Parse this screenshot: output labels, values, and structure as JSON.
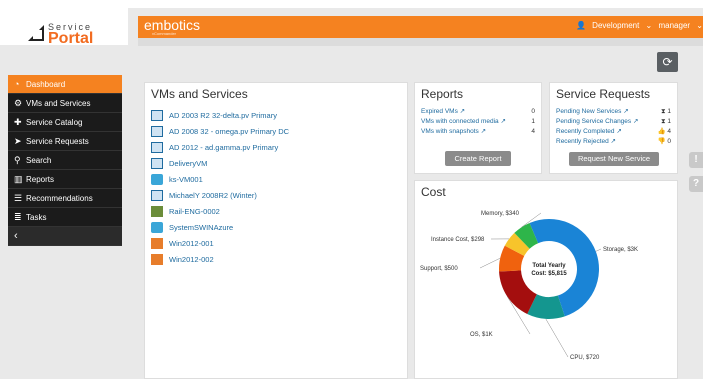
{
  "logo": {
    "service": "Service",
    "portal": "Portal"
  },
  "header": {
    "brand": "embotics",
    "brand_sub": "vCommander",
    "org": "Development",
    "user": "manager"
  },
  "nav": [
    {
      "label": "Dashboard",
      "icon": "dashboard-icon",
      "glyph": "◔",
      "active": true
    },
    {
      "label": "VMs and Services",
      "icon": "vms-icon",
      "glyph": "⚙"
    },
    {
      "label": "Service Catalog",
      "icon": "plus-icon",
      "glyph": "✚"
    },
    {
      "label": "Service Requests",
      "icon": "tag-icon",
      "glyph": "➤"
    },
    {
      "label": "Search",
      "icon": "search-icon",
      "glyph": "⚲"
    },
    {
      "label": "Reports",
      "icon": "bar-chart-icon",
      "glyph": "▥"
    },
    {
      "label": "Recommendations",
      "icon": "sliders-icon",
      "glyph": "☰"
    },
    {
      "label": "Tasks",
      "icon": "tasks-icon",
      "glyph": "≣"
    }
  ],
  "vms": {
    "title": "VMs and Services",
    "items": [
      {
        "label": "AD 2003 R2 32-delta.pv Primary",
        "type": "blue"
      },
      {
        "label": "AD 2008 32 - omega.pv Primary DC",
        "type": "blue"
      },
      {
        "label": "AD 2012 - ad.gamma.pv Primary",
        "type": "blue"
      },
      {
        "label": "DeliveryVM",
        "type": "blue"
      },
      {
        "label": "ks-VM001",
        "type": "teal"
      },
      {
        "label": "MichaelY 2008R2 (Winter)",
        "type": "blue"
      },
      {
        "label": "Rail-ENG-0002",
        "type": "green"
      },
      {
        "label": "SystemSWINAzure",
        "type": "teal"
      },
      {
        "label": "Win2012-001",
        "type": "orange"
      },
      {
        "label": "Win2012-002",
        "type": "orange"
      }
    ]
  },
  "reports": {
    "title": "Reports",
    "rows": [
      {
        "label": "Expired VMs ↗",
        "count": "0"
      },
      {
        "label": "VMs with connected media ↗",
        "count": "1"
      },
      {
        "label": "VMs with snapshots ↗",
        "count": "4"
      }
    ],
    "button": "Create Report"
  },
  "requests": {
    "title": "Service Requests",
    "rows": [
      {
        "label": "Pending New Services ↗",
        "icon": "hourglass-icon",
        "glyph": "⧗",
        "count": "1"
      },
      {
        "label": "Pending Service Changes ↗",
        "icon": "hourglass-icon",
        "glyph": "⧗",
        "count": "1"
      },
      {
        "label": "Recently Completed ↗",
        "icon": "thumbs-up-icon",
        "glyph": "👍",
        "count": "4"
      },
      {
        "label": "Recently Rejected ↗",
        "icon": "thumbs-down-icon",
        "glyph": "👎",
        "count": "0"
      }
    ],
    "button": "Request New Service"
  },
  "cost": {
    "title": "Cost",
    "center_line1": "Total Yearly",
    "center_line2": "Cost: $5,815",
    "slices": [
      {
        "label": "Storage, $3K",
        "value": 3000,
        "color": "#1a84d6"
      },
      {
        "label": "CPU, $720",
        "value": 720,
        "color": "#14968f"
      },
      {
        "label": "OS, $1K",
        "value": 997,
        "color": "#a40e0e"
      },
      {
        "label": "Support, $500",
        "value": 500,
        "color": "#f0620e"
      },
      {
        "label": "Instance Cost, $298",
        "value": 298,
        "color": "#f7c42b"
      },
      {
        "label": "Memory, $340",
        "value": 340,
        "color": "#2eb54a"
      }
    ]
  },
  "colors": {
    "accent": "#f58220",
    "nav_bg": "#1b1b1b",
    "link": "#1f6b9f"
  }
}
